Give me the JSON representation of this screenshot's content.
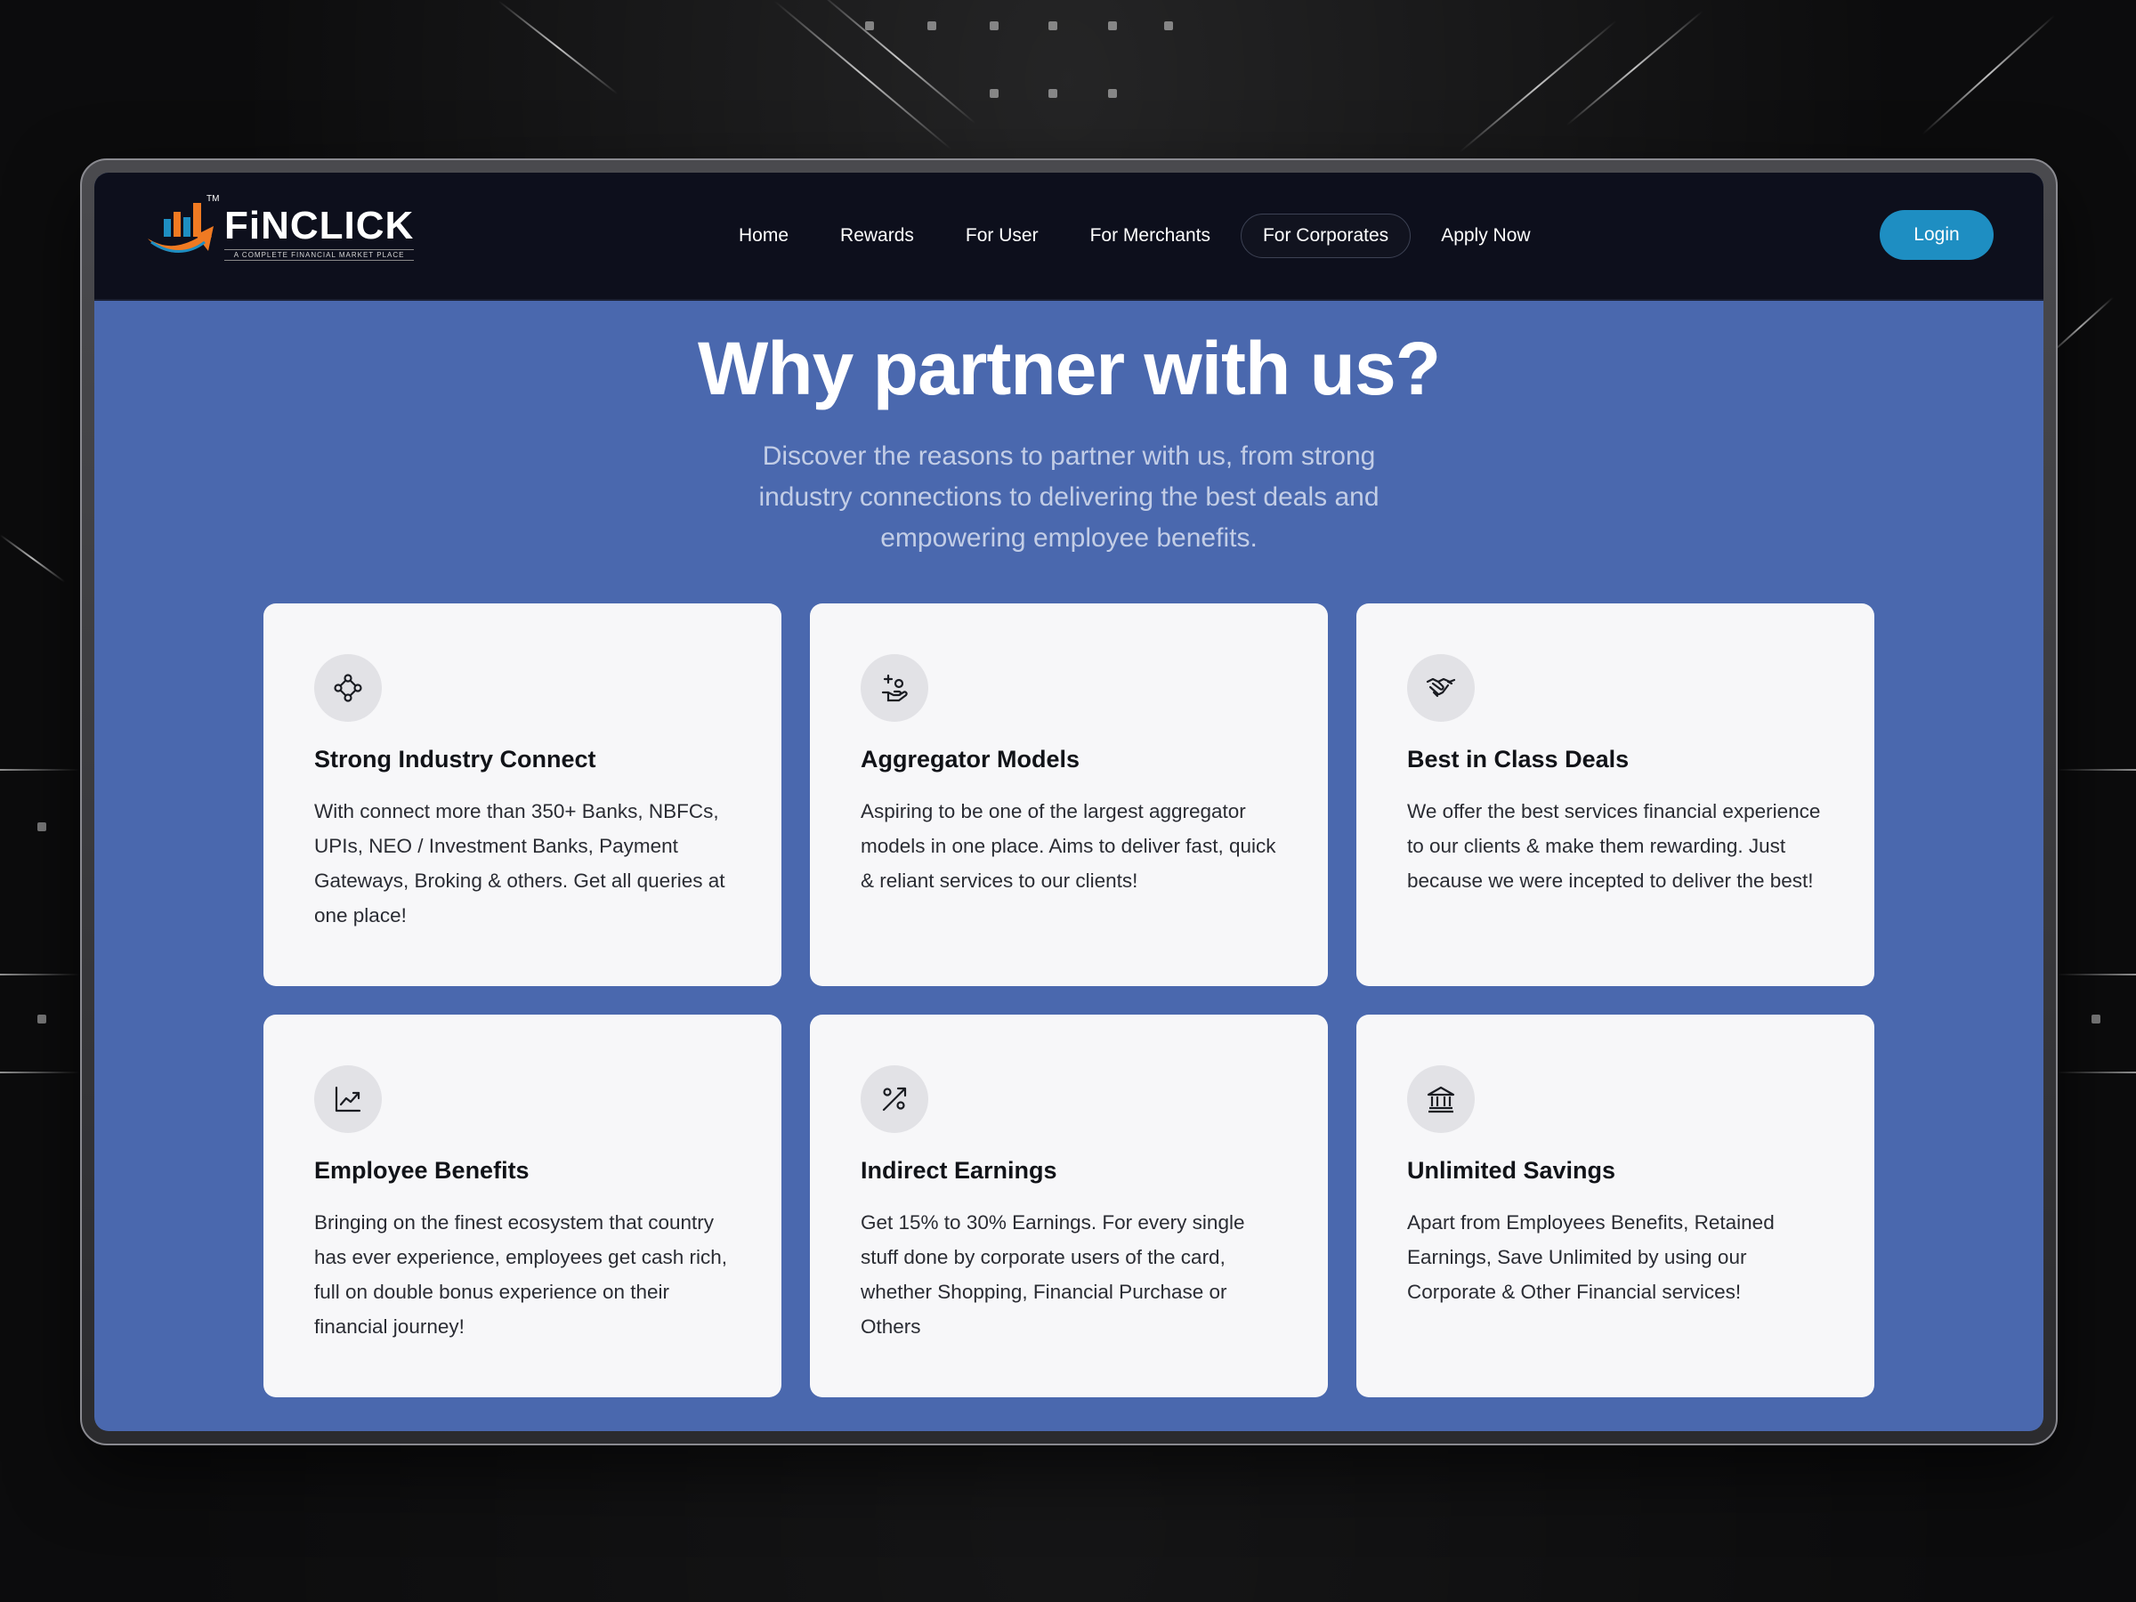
{
  "brand": {
    "name": "FiNCLICK",
    "tagline": "A COMPLETE FINANCIAL MARKET PLACE",
    "trademark": "TM",
    "colors": {
      "orange": "#f07a22",
      "blue": "#1e8ec2"
    }
  },
  "nav": {
    "items": [
      {
        "label": "Home",
        "active": false
      },
      {
        "label": "Rewards",
        "active": false
      },
      {
        "label": "For User",
        "active": false
      },
      {
        "label": "For Merchants",
        "active": false
      },
      {
        "label": "For Corporates",
        "active": true
      },
      {
        "label": "Apply Now",
        "active": false
      }
    ],
    "login_label": "Login"
  },
  "hero": {
    "title": "Why partner with us?",
    "subtitle": "Discover the reasons to partner with us, from strong industry connections to delivering the best deals and empowering employee benefits."
  },
  "cards": [
    {
      "icon": "network-icon",
      "title": "Strong Industry Connect",
      "description": "With connect more than 350+ Banks, NBFCs, UPIs, NEO / Investment Banks, Payment Gateways, Broking & others. Get all queries at one place!"
    },
    {
      "icon": "hand-coin-icon",
      "title": "Aggregator Models",
      "description": "Aspiring to be one of the largest aggregator models in one place. Aims to deliver fast, quick & reliant services to our clients!"
    },
    {
      "icon": "handshake-icon",
      "title": "Best in Class Deals",
      "description": "We offer the best services financial experience to our clients & make them rewarding. Just because we were incepted to deliver the best!"
    },
    {
      "icon": "trend-chart-icon",
      "title": "Employee Benefits",
      "description": "Bringing on the finest ecosystem that country has ever experience, employees get cash rich, full on double bonus experience on their financial journey!"
    },
    {
      "icon": "percent-icon",
      "title": "Indirect Earnings",
      "description": "Get 15% to 30% Earnings. For every single stuff done by corporate users of the card, whether Shopping, Financial Purchase or Others"
    },
    {
      "icon": "bank-icon",
      "title": "Unlimited Savings",
      "description": "Apart from Employees Benefits, Retained Earnings, Save Unlimited by using our Corporate & Other Financial services!"
    }
  ]
}
